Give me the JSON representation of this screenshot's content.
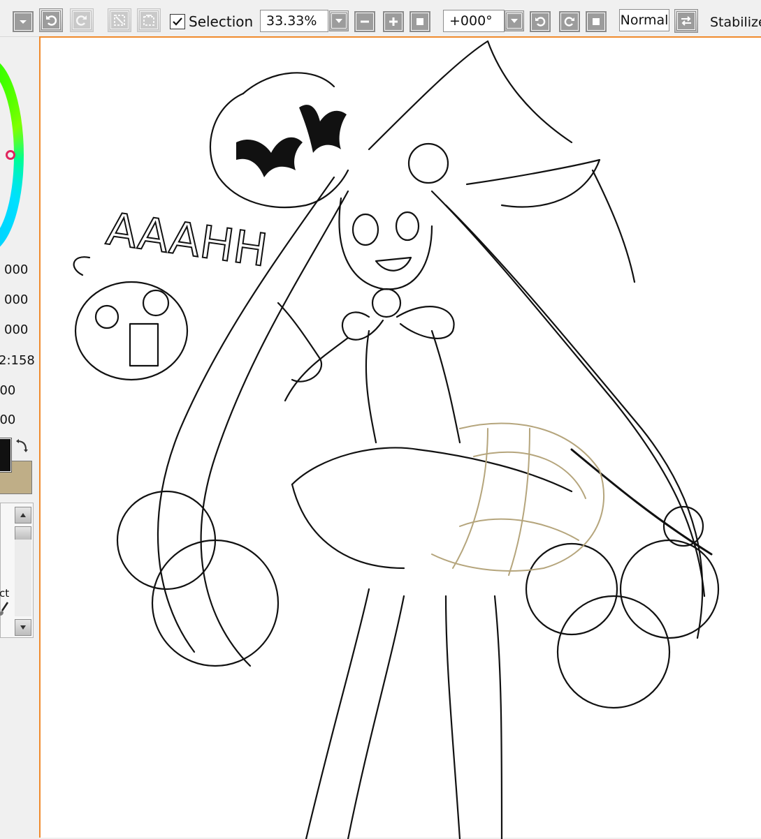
{
  "toolbar": {
    "selection_label": "Selection",
    "selection_checked": true,
    "zoom_value": "33.33%",
    "rotation_value": "+000°",
    "blend_mode": "Normal",
    "stabilizer_label": "Stabilize"
  },
  "left_panel": {
    "params": [
      "000",
      "000",
      "000",
      "2:158",
      "000",
      "000"
    ],
    "brush_text": "ct",
    "primary_color": "#111111",
    "secondary_color": "#bfae87",
    "wheel_colors": [
      "#00c8ff",
      "#00ff60",
      "#20ff00"
    ]
  },
  "canvas": {
    "sketch_text": "AAAHH"
  },
  "icons": [
    "menu-dropdown-icon",
    "undo-icon",
    "redo-icon",
    "deselect-icon",
    "invert-selection-icon",
    "checkbox-icon",
    "zoom-dropdown-icon",
    "zoom-out-icon",
    "zoom-in-icon",
    "zoom-reset-icon",
    "rotation-dropdown-icon",
    "rotate-ccw-icon",
    "rotate-cw-icon",
    "rotate-reset-icon",
    "flip-icon",
    "swap-colors-icon"
  ]
}
